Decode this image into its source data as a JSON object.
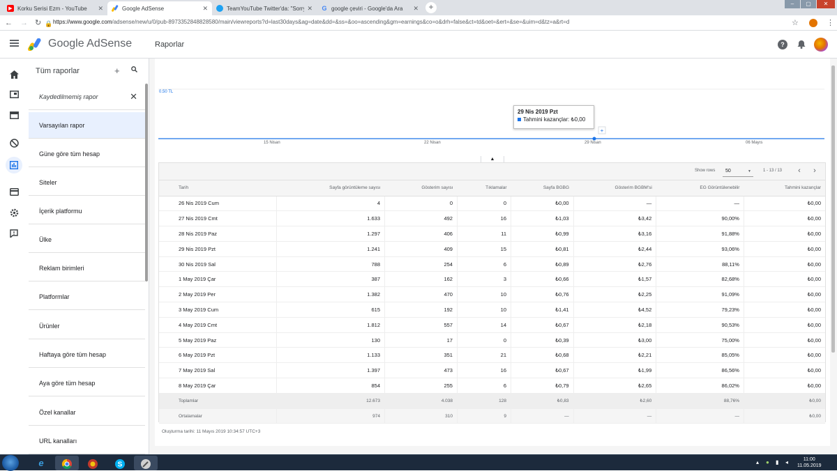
{
  "browser": {
    "tabs": [
      {
        "title": "Korku Serisi Ezm - YouTube",
        "icon": "youtube-icon",
        "color": "#ff0000"
      },
      {
        "title": "Google AdSense",
        "icon": "adsense-icon",
        "color": "#fbbc04"
      },
      {
        "title": "TeamYouTube Twitter'da: \"Sorry",
        "icon": "twitter-icon",
        "color": "#1da1f2"
      },
      {
        "title": "google çeviri - Google'da Ara",
        "icon": "google-icon",
        "color": "#4285f4"
      }
    ],
    "url_host": "https://www.google.com",
    "url_path": "/adsense/new/u/0/pub-8973352848828580/main/viewreports?d=last30days&ag=date&dd=&ss=&oo=ascending&gm=earnings&co=o&drh=false&ct=td&oet=&ert=&se=&uim=d&tz=a&rt=d"
  },
  "header": {
    "brand": "Google AdSense",
    "page_title": "Raporlar"
  },
  "panel": {
    "title": "Tüm raporlar",
    "items": [
      "Kaydedilmemiş rapor",
      "Varsayılan rapor",
      "Güne göre tüm hesap",
      "Siteler",
      "İçerik platformu",
      "Ülke",
      "Reklam birimleri",
      "Platformlar",
      "Ürünler",
      "Haftaya göre tüm hesap",
      "Aya göre tüm hesap",
      "Özel kanallar",
      "URL kanalları"
    ]
  },
  "chart_data": {
    "type": "line",
    "ylabel_max": "0.50 TL",
    "x_ticks": [
      "15 Nisan",
      "22 Nisan",
      "29 Nisan",
      "06 Mayıs"
    ],
    "series": [
      {
        "name": "Tahmini kazançlar",
        "values_label": "Tahmini kazançlar: ₺0,00"
      }
    ],
    "tooltip": {
      "date": "29 Nis 2019 Pzt",
      "label": "Tahmini kazançlar:",
      "value": "₺0,00"
    },
    "series_color": "#1a73e8"
  },
  "table": {
    "show_rows_label": "Show rows",
    "rows_per_page": "50",
    "page_range": "1 - 13 / 13",
    "columns": [
      "Tarih",
      "Sayfa görüntüleme sayısı",
      "Gösterim sayısı",
      "Tıklamalar",
      "Sayfa BGBG",
      "Gösterim BGBM'si",
      "EG Görüntülenebilir",
      "Tahmini kazançlar"
    ],
    "rows": [
      [
        "26 Nis 2019 Cum",
        "4",
        "0",
        "0",
        "₺0,00",
        "—",
        "—",
        "₺0,00"
      ],
      [
        "27 Nis 2019 Cmt",
        "1.633",
        "492",
        "16",
        "₺1,03",
        "₺3,42",
        "90,00%",
        "₺0,00"
      ],
      [
        "28 Nis 2019 Paz",
        "1.297",
        "406",
        "11",
        "₺0,99",
        "₺3,16",
        "91,88%",
        "₺0,00"
      ],
      [
        "29 Nis 2019 Pzt",
        "1.241",
        "409",
        "15",
        "₺0,81",
        "₺2,44",
        "93,06%",
        "₺0,00"
      ],
      [
        "30 Nis 2019 Sal",
        "788",
        "254",
        "6",
        "₺0,89",
        "₺2,76",
        "88,11%",
        "₺0,00"
      ],
      [
        "1 May 2019 Çar",
        "387",
        "162",
        "3",
        "₺0,66",
        "₺1,57",
        "82,68%",
        "₺0,00"
      ],
      [
        "2 May 2019 Per",
        "1.382",
        "470",
        "10",
        "₺0,76",
        "₺2,25",
        "91,09%",
        "₺0,00"
      ],
      [
        "3 May 2019 Cum",
        "615",
        "192",
        "10",
        "₺1,41",
        "₺4,52",
        "79,23%",
        "₺0,00"
      ],
      [
        "4 May 2019 Cmt",
        "1.812",
        "557",
        "14",
        "₺0,67",
        "₺2,18",
        "90,53%",
        "₺0,00"
      ],
      [
        "5 May 2019 Paz",
        "130",
        "17",
        "0",
        "₺0,39",
        "₺3,00",
        "75,00%",
        "₺0,00"
      ],
      [
        "6 May 2019 Pzt",
        "1.133",
        "351",
        "21",
        "₺0,68",
        "₺2,21",
        "85,05%",
        "₺0,00"
      ],
      [
        "7 May 2019 Sal",
        "1.397",
        "473",
        "16",
        "₺0,67",
        "₺1,99",
        "86,56%",
        "₺0,00"
      ],
      [
        "8 May 2019 Çar",
        "854",
        "255",
        "6",
        "₺0,79",
        "₺2,65",
        "86,02%",
        "₺0,00"
      ]
    ],
    "totals": [
      "Toplamlar",
      "12.673",
      "4.038",
      "128",
      "₺0,83",
      "₺2,60",
      "88,76%",
      "₺0,00"
    ],
    "averages": [
      "Ortalamalar",
      "974",
      "310",
      "9",
      "—",
      "—",
      "—",
      "₺0,00"
    ],
    "created": "Oluşturma tarihi: 11 Mayıs 2019 10:34:57 UTC+3"
  },
  "taskbar": {
    "time": "11:00",
    "date": "11.05.2019",
    "apps": [
      "ie-icon",
      "chrome-icon",
      "game-icon",
      "skype-icon",
      "tool-icon"
    ]
  }
}
